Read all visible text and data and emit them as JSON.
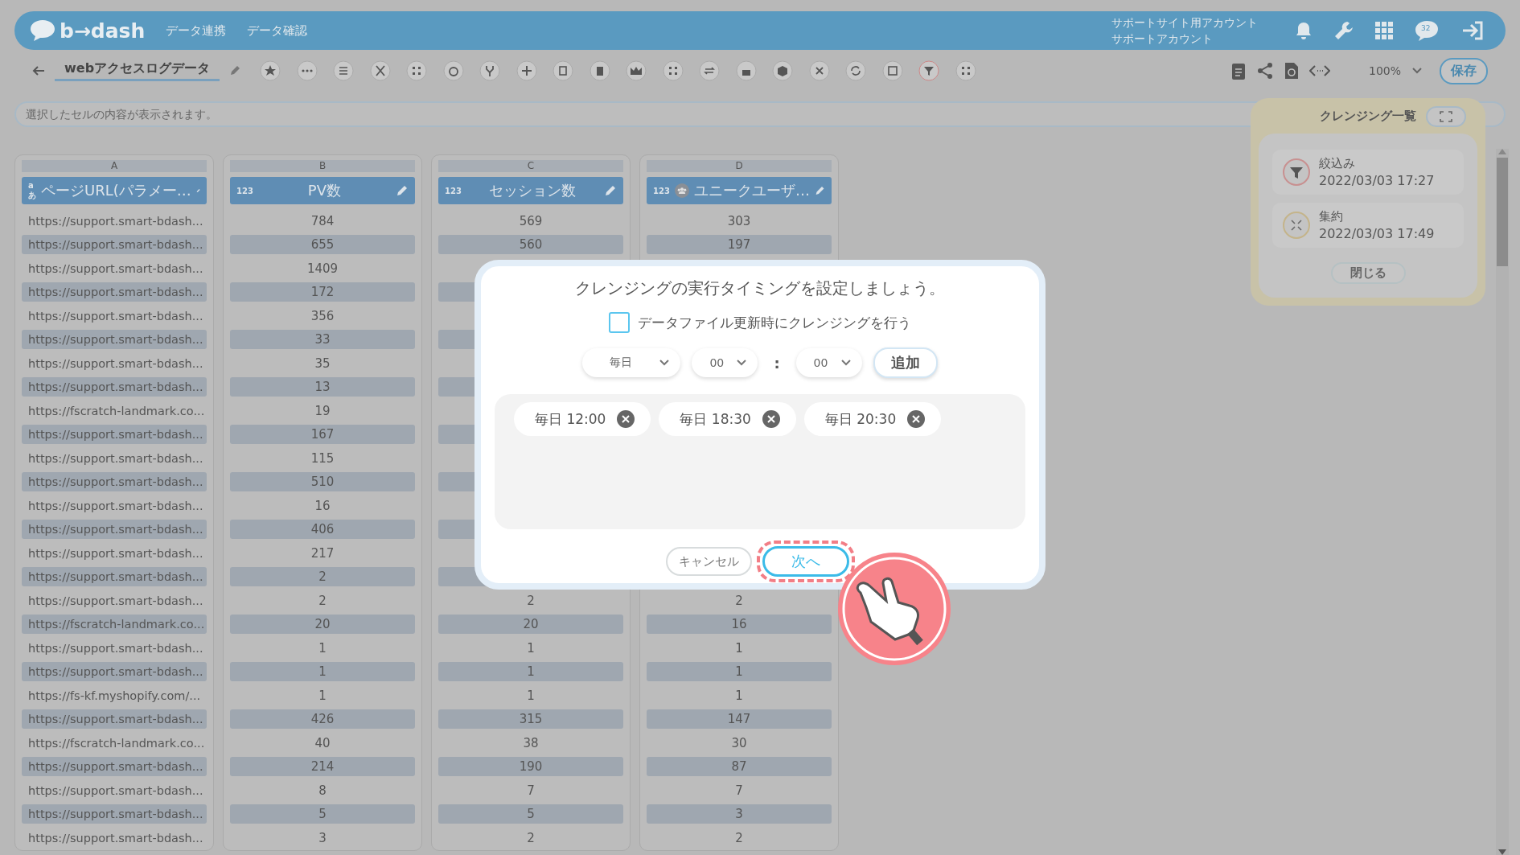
{
  "header": {
    "logo": "b→dash",
    "nav": [
      {
        "label": "データ連携"
      },
      {
        "label": "データ確認"
      }
    ],
    "account": [
      "サポートサイト用アカウント",
      "サポートアカウント"
    ],
    "badge": "32"
  },
  "toolbar": {
    "title": "webアクセスログデータ",
    "zoom": "100%",
    "save": "保存"
  },
  "cell_preview": {
    "placeholder": "選択したセルの内容が表示されます。"
  },
  "columns": [
    {
      "letter": "A",
      "kind": "text",
      "type": "aあ",
      "name": "ページURL(パラメー…",
      "user_icon": false
    },
    {
      "letter": "B",
      "kind": "number",
      "type": "123",
      "name": "PV数",
      "user_icon": false
    },
    {
      "letter": "C",
      "kind": "number",
      "type": "123",
      "name": "セッション数",
      "user_icon": false
    },
    {
      "letter": "D",
      "kind": "number",
      "type": "123",
      "name": "ユニークユーザ…",
      "user_icon": true
    }
  ],
  "rows": [
    [
      "https://support.smart-bdash...",
      "784",
      "569",
      "303"
    ],
    [
      "https://support.smart-bdash...",
      "655",
      "560",
      "197"
    ],
    [
      "https://support.smart-bdash...",
      "1409",
      null,
      null
    ],
    [
      "https://support.smart-bdash...",
      "172",
      null,
      null
    ],
    [
      "https://support.smart-bdash...",
      "356",
      null,
      null
    ],
    [
      "https://support.smart-bdash...",
      "33",
      null,
      null
    ],
    [
      "https://support.smart-bdash...",
      "35",
      null,
      null
    ],
    [
      "https://support.smart-bdash...",
      "13",
      null,
      null
    ],
    [
      "https://fscratch-landmark.co...",
      "19",
      null,
      null
    ],
    [
      "https://support.smart-bdash...",
      "167",
      null,
      null
    ],
    [
      "https://support.smart-bdash...",
      "115",
      null,
      null
    ],
    [
      "https://support.smart-bdash...",
      "510",
      null,
      null
    ],
    [
      "https://support.smart-bdash...",
      "16",
      null,
      null
    ],
    [
      "https://support.smart-bdash...",
      "406",
      null,
      null
    ],
    [
      "https://support.smart-bdash...",
      "217",
      null,
      null
    ],
    [
      "https://support.smart-bdash...",
      "2",
      null,
      null
    ],
    [
      "https://support.smart-bdash...",
      "2",
      "2",
      "2"
    ],
    [
      "https://fscratch-landmark.co...",
      "20",
      "20",
      "16"
    ],
    [
      "https://support.smart-bdash...",
      "1",
      "1",
      "1"
    ],
    [
      "https://support.smart-bdash...",
      "1",
      "1",
      "1"
    ],
    [
      "https://fs-kf.myshopify.com/...",
      "1",
      "1",
      "1"
    ],
    [
      "https://support.smart-bdash...",
      "426",
      "315",
      "147"
    ],
    [
      "https://fscratch-landmark.co...",
      "40",
      "38",
      "30"
    ],
    [
      "https://support.smart-bdash...",
      "214",
      "190",
      "87"
    ],
    [
      "https://support.smart-bdash...",
      "8",
      "7",
      "7"
    ],
    [
      "https://support.smart-bdash...",
      "5",
      "5",
      "3"
    ],
    [
      "https://support.smart-bdash...",
      "3",
      "2",
      "2"
    ]
  ],
  "cleansing_panel": {
    "title": "クレンジング一覧",
    "items": [
      {
        "kind": "filter",
        "name": "絞込み",
        "date": "2022/03/03 17:27"
      },
      {
        "kind": "aggregate",
        "name": "集約",
        "date": "2022/03/03 17:49"
      }
    ],
    "close": "閉じる"
  },
  "dialog": {
    "title": "クレンジングの実行タイミングを設定しましょう。",
    "checkbox": {
      "label": "データファイル更新時にクレンジングを行う",
      "checked": false
    },
    "frequency": "毎日",
    "hour": "00",
    "separator": ":",
    "minute": "00",
    "add": "追加",
    "schedules": [
      {
        "label": "毎日 12:00"
      },
      {
        "label": "毎日 18:30"
      },
      {
        "label": "毎日 20:30"
      }
    ],
    "cancel": "キャンセル",
    "next": "次へ",
    "next_highlighted": true
  }
}
